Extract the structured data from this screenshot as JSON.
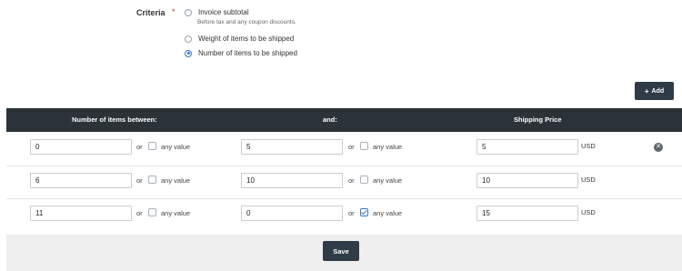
{
  "criteria": {
    "label": "Criteria",
    "required_mark": "*",
    "options": [
      {
        "label": "Invoice subtotal",
        "hint": "Before tax and any coupon discounts.",
        "checked": false
      },
      {
        "label": "Weight of items to be shipped",
        "checked": false
      },
      {
        "label": "Number of items to be shipped",
        "checked": true
      }
    ]
  },
  "add_button": {
    "icon": "plus-icon",
    "label": "Add"
  },
  "table": {
    "headers": [
      "Number of items between:",
      "and:",
      "Shipping Price"
    ],
    "or_label": "or",
    "any_value_label": "any value",
    "currency": "USD",
    "rows": [
      {
        "from": "0",
        "from_any": false,
        "to": "5",
        "to_any": false,
        "price": "5",
        "removable": true
      },
      {
        "from": "6",
        "from_any": false,
        "to": "10",
        "to_any": false,
        "price": "10",
        "removable": false
      },
      {
        "from": "11",
        "from_any": false,
        "to": "0",
        "to_any": true,
        "price": "15",
        "removable": false
      }
    ]
  },
  "save_button": {
    "label": "Save"
  },
  "colors": {
    "header_bg": "#2b3339",
    "button_bg": "#2f3b46",
    "accent": "#3a77c4"
  }
}
